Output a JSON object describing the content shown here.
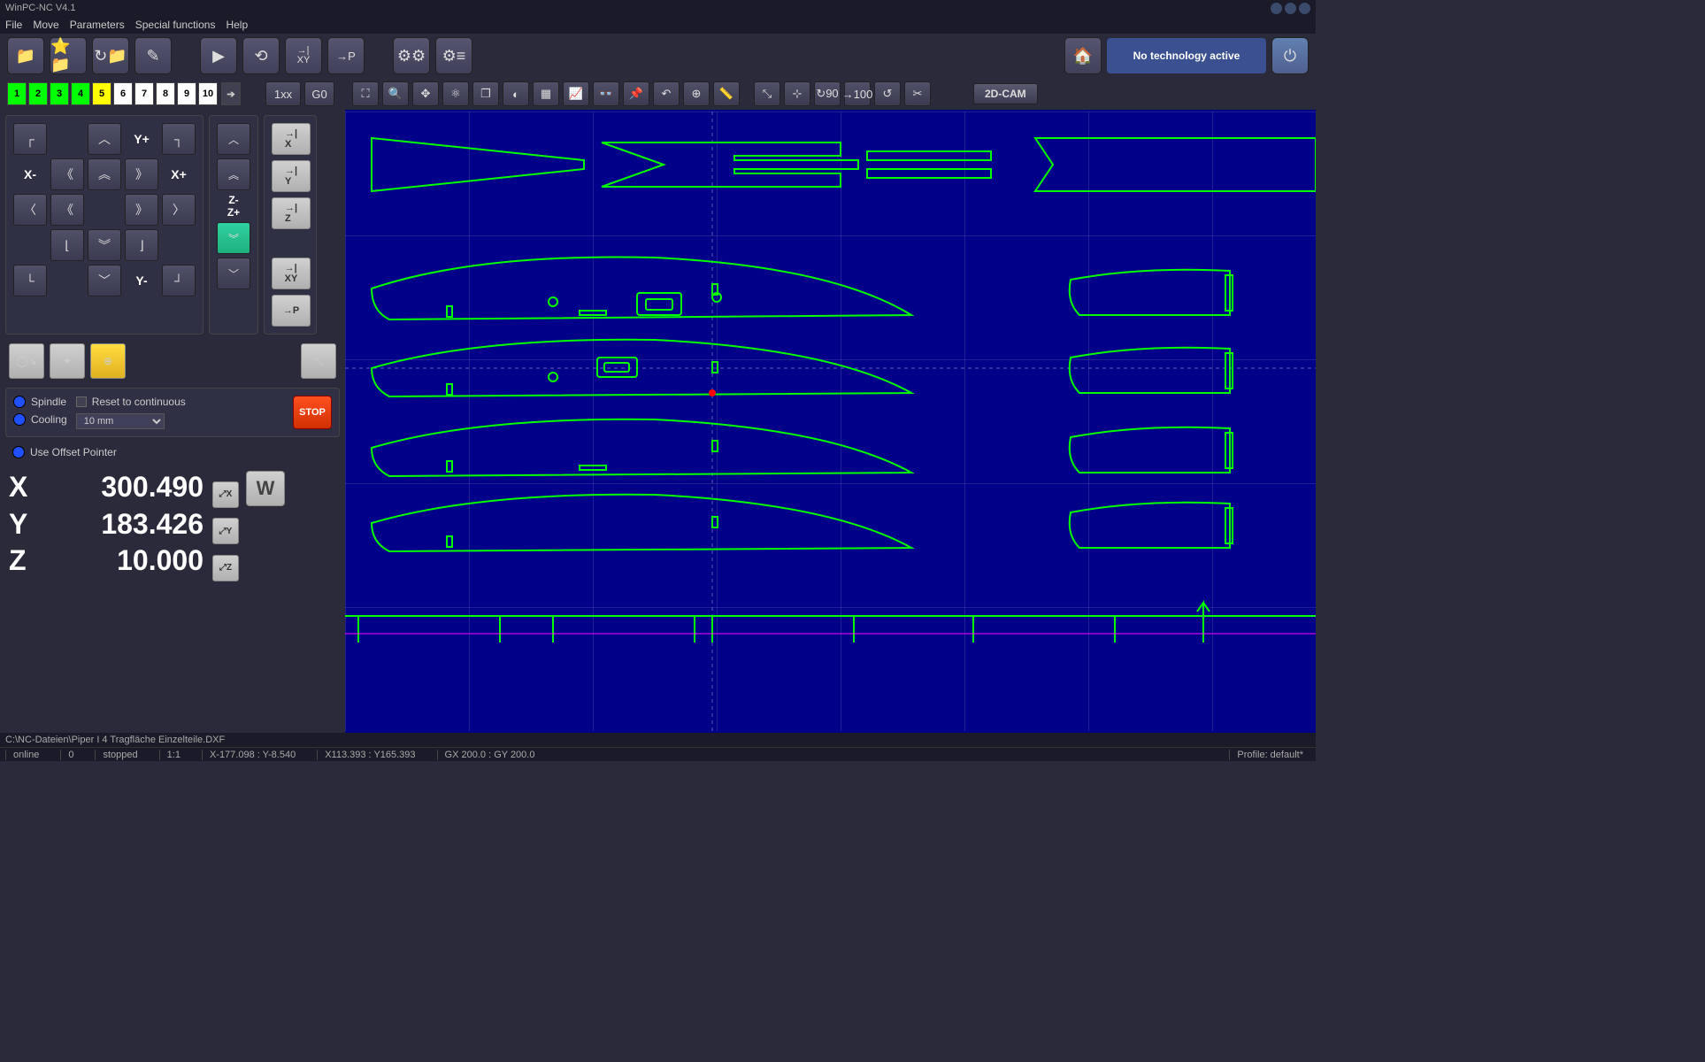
{
  "title": "WinPC-NC V4.1",
  "menu": [
    "File",
    "Move",
    "Parameters",
    "Special functions",
    "Help"
  ],
  "tech_status": "No technology active",
  "layers": [
    {
      "n": "1",
      "cls": "l-green"
    },
    {
      "n": "2",
      "cls": "l-green"
    },
    {
      "n": "3",
      "cls": "l-green"
    },
    {
      "n": "4",
      "cls": "l-green"
    },
    {
      "n": "5",
      "cls": "l-yellow"
    },
    {
      "n": "6",
      "cls": "l-white"
    },
    {
      "n": "7",
      "cls": "l-white"
    },
    {
      "n": "8",
      "cls": "l-white"
    },
    {
      "n": "9",
      "cls": "l-white"
    },
    {
      "n": "10",
      "cls": "l-white"
    }
  ],
  "override": {
    "lbl_1xx": "1xx",
    "lbl_g0": "G0"
  },
  "jog": {
    "yp": "Y+",
    "ym": "Y-",
    "xp": "X+",
    "xm": "X-",
    "zp": "Z+",
    "zm": "Z-"
  },
  "ref": {
    "x": "→|\nX",
    "y": "→|\nY",
    "z": "→|\nZ",
    "xy": "→|\nXY",
    "p": "→P"
  },
  "controls": {
    "spindle": "Spindle",
    "cooling": "Cooling",
    "reset": "Reset to continuous",
    "step": "10 mm",
    "offset": "Use Offset Pointer",
    "stop": "STOP"
  },
  "coords": {
    "x": {
      "ax": "X",
      "val": "300.490",
      "btn": "⤢\nX"
    },
    "y": {
      "ax": "Y",
      "val": "183.426",
      "btn": "⤢\nY"
    },
    "z": {
      "ax": "Z",
      "val": "10.000",
      "btn": "⤢\nZ"
    },
    "w": "W"
  },
  "cam_btn": "2D-CAM",
  "status": {
    "file": "C:\\NC-Dateien\\Piper I 4 Tragfläche Einzelteile.DXF",
    "online": "online",
    "zero": "0",
    "stopped": "stopped",
    "ratio": "1:1",
    "coords1": "X-177.098 : Y-8.540",
    "coords2": "X113.393 : Y165.393",
    "gxy": "GX 200.0 : GY 200.0",
    "profile": "Profile: default*"
  }
}
